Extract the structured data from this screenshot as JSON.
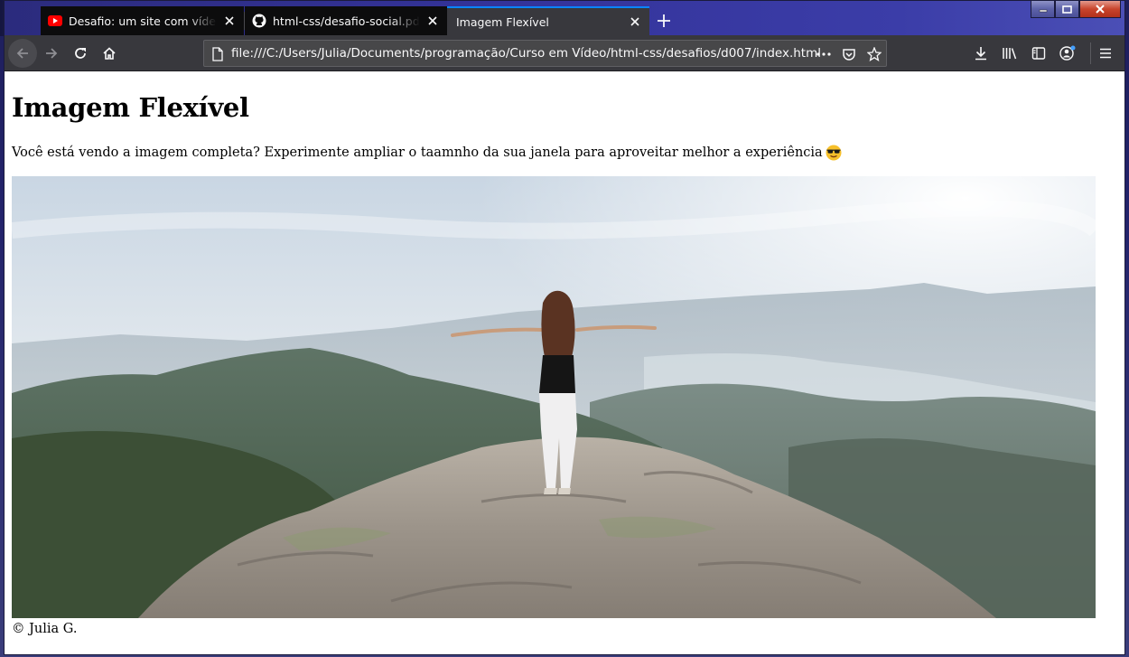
{
  "tabs": [
    {
      "title": "Desafio: um site com vídeos - C",
      "favicon": "youtube-icon",
      "active": false
    },
    {
      "title": "html-css/desafio-social.pdf at m",
      "favicon": "github-icon",
      "active": false
    },
    {
      "title": "Imagem Flexível",
      "favicon": "none",
      "active": true
    }
  ],
  "navbar": {
    "url": "file:///C:/Users/Julia/Documents/programação/Curso em Vídeo/html-css/desafios/d007/index.html"
  },
  "page": {
    "heading": "Imagem Flexível",
    "intro": "Você está vendo a imagem completa? Experimente ampliar o taamnho da sua janela para aproveitar melhor a experiência",
    "footer": "© Julia G."
  },
  "colors": {
    "titlebar": "#2b2b7d",
    "toolbar": "#38383d",
    "active_tab_accent": "#0a84ff",
    "youtube_red": "#ff0000",
    "close_red": "#c8442c"
  },
  "icons": [
    "back-arrow-icon",
    "forward-arrow-icon",
    "reload-icon",
    "home-icon",
    "page-icon",
    "more-icon",
    "pocket-icon",
    "star-icon",
    "download-icon",
    "library-icon",
    "sidebar-icon",
    "account-icon",
    "menu-icon",
    "sunglasses-emoji-icon"
  ]
}
